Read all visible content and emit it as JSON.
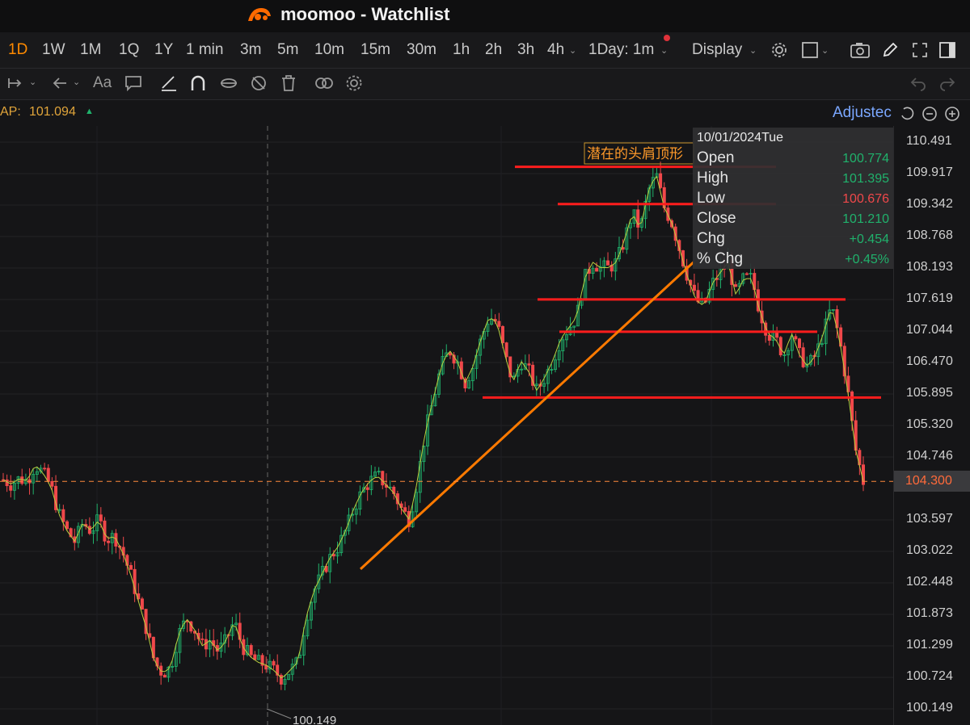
{
  "window": {
    "title": "moomoo - Watchlist"
  },
  "timeframes": [
    {
      "label": "1D",
      "active": true
    },
    {
      "label": "1W"
    },
    {
      "label": "1M"
    },
    {
      "label": "1Q"
    },
    {
      "label": "1Y"
    },
    {
      "label": "1 min"
    },
    {
      "label": "3m"
    },
    {
      "label": "5m"
    },
    {
      "label": "10m"
    },
    {
      "label": "15m"
    },
    {
      "label": "30m"
    },
    {
      "label": "1h"
    },
    {
      "label": "2h"
    },
    {
      "label": "3h"
    },
    {
      "label": "4h"
    }
  ],
  "toolbar": {
    "interval_select": "1Day: 1m",
    "display_menu": "Display"
  },
  "indicator": {
    "label": "AP:",
    "value": "101.094",
    "adjusted_label": "Adjustec"
  },
  "annotation": {
    "text": "潜在的头肩顶形"
  },
  "tooltip": {
    "date": "10/01/2024Tue",
    "rows": [
      {
        "label": "Open",
        "value": "100.774"
      },
      {
        "label": "High",
        "value": "101.395"
      },
      {
        "label": "Low",
        "value": "100.676"
      },
      {
        "label": "Close",
        "value": "101.210"
      },
      {
        "label": "Chg",
        "value": "+0.454"
      },
      {
        "label": "% Chg",
        "value": "+0.45%"
      }
    ]
  },
  "price_axis": {
    "ticks": [
      "110.491",
      "109.917",
      "109.342",
      "108.768",
      "108.193",
      "107.619",
      "107.044",
      "106.470",
      "105.895",
      "105.320",
      "104.746",
      "103.597",
      "103.022",
      "102.448",
      "101.873",
      "101.299",
      "100.724",
      "100.149"
    ],
    "current_price": "104.300",
    "low_marker": "100.149"
  },
  "colors": {
    "accent": "#ff8a00",
    "up": "#20b26c",
    "down": "#f0484a",
    "level_line": "#ff1d1d",
    "trend_line": "#ff7a00",
    "background": "#151517"
  },
  "chart_data": {
    "type": "candlestick",
    "ylim": [
      100.149,
      110.491
    ],
    "levels": [
      110.04,
      109.36,
      107.62,
      107.03,
      105.83
    ],
    "trendline": [
      [
        0.0,
        102.7
      ],
      [
        1.0,
        108.3
      ]
    ],
    "closes": [
      104.33,
      104.25,
      104.35,
      104.31,
      104.6,
      104.45,
      104.2,
      103.7,
      103.4,
      103.2,
      103.55,
      103.4,
      103.6,
      103.25,
      103.3,
      103.0,
      102.6,
      102.1,
      101.6,
      101.0,
      100.8,
      100.9,
      101.5,
      101.8,
      101.6,
      101.3,
      101.4,
      101.2,
      101.4,
      101.75,
      101.3,
      101.1,
      101.0,
      100.95,
      100.85,
      100.7,
      100.85,
      101.0,
      101.8,
      102.3,
      102.6,
      102.9,
      103.1,
      103.4,
      103.8,
      104.1,
      104.3,
      104.4,
      104.25,
      104.1,
      103.8,
      103.6,
      104.3,
      105.2,
      105.8,
      106.4,
      106.7,
      106.5,
      106.1,
      106.4,
      106.9,
      107.3,
      107.2,
      106.6,
      106.1,
      106.5,
      106.3,
      105.95,
      106.2,
      106.5,
      106.9,
      107.1,
      107.3,
      108.0,
      108.3,
      108.2,
      108.2,
      108.3,
      108.7,
      109.2,
      108.9,
      109.6,
      109.9,
      109.3,
      109.0,
      108.5,
      108.0,
      107.6,
      107.5,
      107.9,
      108.1,
      108.3,
      107.7,
      108.0,
      108.0,
      107.4,
      107.0,
      106.9,
      106.6,
      107.0,
      106.6,
      106.4,
      106.6,
      107.0,
      107.5,
      106.9,
      106.0,
      104.9,
      104.3
    ]
  }
}
